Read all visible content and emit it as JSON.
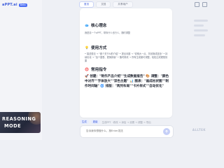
{
  "app": {
    "brand": "aPPT.ai",
    "brand_badge": "Beta"
  },
  "tabs": [
    {
      "label": "首页",
      "active": true
    },
    {
      "label": "文档"
    },
    {
      "label": "共享用户"
    }
  ],
  "sections": {
    "core": {
      "title": "核心理念",
      "icon": "cloud-icon",
      "text": "我是另一个aPPT，帮你什么也行么，随时调整"
    },
    "usage": {
      "title": "使用方式",
      "icon": "lightbulb-icon",
      "text": "• 描述想法 → \"做个关于AI的介绍\" • 提出问题 → \"说明大一点、背景换成蓝色\" • 持续优化 → \"加个图表、更换排版\" • 随时修改 → 所有生成都可调整，轻松达成理想效果"
    },
    "commands": {
      "title": "常用指令",
      "icon": "target-icon",
      "text": "🚀 创建：\"制作产品介绍\"\"生成数据报告\" 🎨 调整：\"颜色中对齐\"\"字体放大\"\"深色主题\" 📊 图表：\"画成柱状图\"\"制作时间轴\" 🌀 排版：\"两列布局\"\"卡片样式\"\"自动优化\""
    }
  },
  "quick_bar": {
    "chips": [
      "生成",
      "超级"
    ],
    "hint": "生成PPT · 修改 → 添加 → 设置 → 调整 → 导出"
  },
  "input": {
    "placeholder": "告诉我你想做什么，按Enter发送"
  },
  "promo": {
    "line1": "REASONING",
    "line2": "MODE"
  },
  "watermark": "ALLTEK",
  "colors": {
    "accent": "#3b5bdb",
    "background": "#eef0f5",
    "card": "#ffffff"
  }
}
